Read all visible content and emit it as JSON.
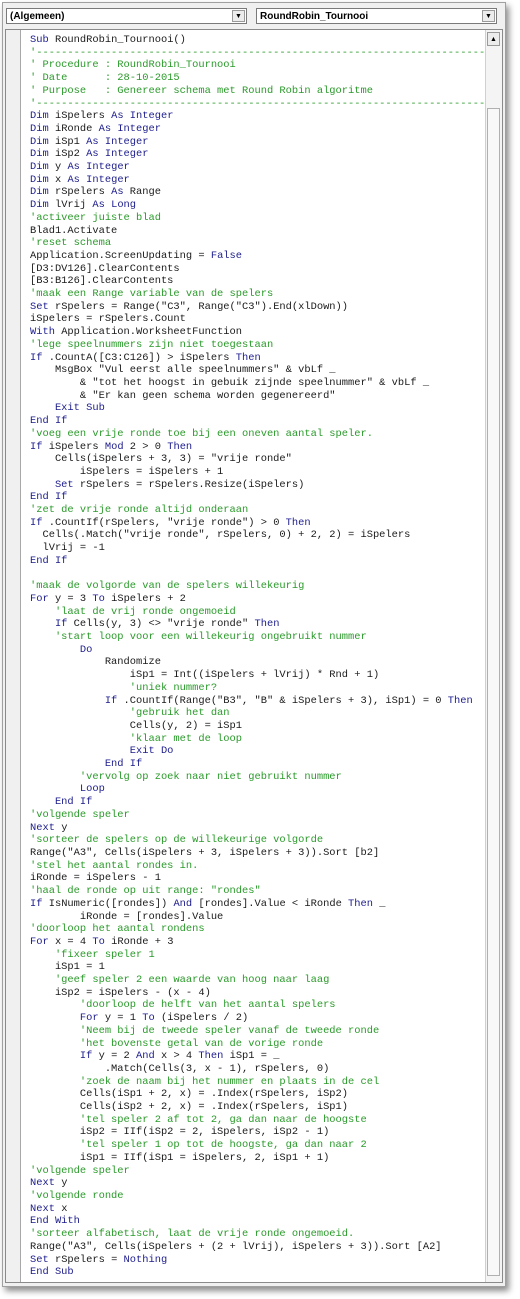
{
  "header": {
    "object_dropdown": "(Algemeen)",
    "procedure_dropdown": "RoundRobin_Tournooi",
    "dropdown_arrow_icon": "▼"
  },
  "scrollbar": {
    "up_arrow_icon": "▲"
  },
  "colors": {
    "keyword": "#1c1c8c",
    "comment": "#2a9a2a",
    "text": "#1a1a1a"
  },
  "code": [
    [
      [
        "k",
        "Sub "
      ],
      [
        "n",
        "RoundRobin_Tournooi()"
      ]
    ],
    [
      [
        "c",
        "'------------------------------------------------------------------------------"
      ]
    ],
    [
      [
        "c",
        "' Procedure : RoundRobin_Tournooi"
      ]
    ],
    [
      [
        "c",
        "' Date      : 28-10-2015"
      ]
    ],
    [
      [
        "c",
        "' Purpose   : Genereer schema met Round Robin algoritme"
      ]
    ],
    [
      [
        "c",
        "'------------------------------------------------------------------------------"
      ]
    ],
    [
      [
        "k",
        "Dim "
      ],
      [
        "n",
        "iSpelers "
      ],
      [
        "k",
        "As Integer"
      ]
    ],
    [
      [
        "k",
        "Dim "
      ],
      [
        "n",
        "iRonde "
      ],
      [
        "k",
        "As Integer"
      ]
    ],
    [
      [
        "k",
        "Dim "
      ],
      [
        "n",
        "iSp1 "
      ],
      [
        "k",
        "As Integer"
      ]
    ],
    [
      [
        "k",
        "Dim "
      ],
      [
        "n",
        "iSp2 "
      ],
      [
        "k",
        "As Integer"
      ]
    ],
    [
      [
        "k",
        "Dim "
      ],
      [
        "n",
        "y "
      ],
      [
        "k",
        "As Integer"
      ]
    ],
    [
      [
        "k",
        "Dim "
      ],
      [
        "n",
        "x "
      ],
      [
        "k",
        "As Integer"
      ]
    ],
    [
      [
        "k",
        "Dim "
      ],
      [
        "n",
        "rSpelers "
      ],
      [
        "k",
        "As "
      ],
      [
        "n",
        "Range"
      ]
    ],
    [
      [
        "k",
        "Dim "
      ],
      [
        "n",
        "lVrij "
      ],
      [
        "k",
        "As Long"
      ]
    ],
    [
      [
        "c",
        "'activeer juiste blad"
      ]
    ],
    [
      [
        "n",
        "Blad1.Activate"
      ]
    ],
    [
      [
        "c",
        "'reset schema"
      ]
    ],
    [
      [
        "n",
        "Application.ScreenUpdating = "
      ],
      [
        "k",
        "False"
      ]
    ],
    [
      [
        "n",
        "[D3:DV126].ClearContents"
      ]
    ],
    [
      [
        "n",
        "[B3:B126].ClearContents"
      ]
    ],
    [
      [
        "c",
        "'maak een Range variable van de spelers"
      ]
    ],
    [
      [
        "k",
        "Set "
      ],
      [
        "n",
        "rSpelers = Range(\"C3\", Range(\"C3\").End(xlDown))"
      ]
    ],
    [
      [
        "n",
        "iSpelers = rSpelers.Count"
      ]
    ],
    [
      [
        "k",
        "With "
      ],
      [
        "n",
        "Application.WorksheetFunction"
      ]
    ],
    [
      [
        "c",
        "'lege speelnummers zijn niet toegestaan"
      ]
    ],
    [
      [
        "k",
        "If "
      ],
      [
        "n",
        ".CountA([C3:C126]) > iSpelers "
      ],
      [
        "k",
        "Then"
      ]
    ],
    [
      [
        "n",
        "    MsgBox \"Vul eerst alle speelnummers\" & vbLf _"
      ]
    ],
    [
      [
        "n",
        "        & \"tot het hoogst in gebuik zijnde speelnummer\" & vbLf _"
      ]
    ],
    [
      [
        "n",
        "        & \"Er kan geen schema worden gegenereerd\""
      ]
    ],
    [
      [
        "k",
        "    Exit Sub"
      ]
    ],
    [
      [
        "k",
        "End If"
      ]
    ],
    [
      [
        "c",
        "'voeg een vrije ronde toe bij een oneven aantal speler."
      ]
    ],
    [
      [
        "k",
        "If "
      ],
      [
        "n",
        "iSpelers "
      ],
      [
        "k",
        "Mod "
      ],
      [
        "n",
        "2 > 0 "
      ],
      [
        "k",
        "Then"
      ]
    ],
    [
      [
        "n",
        "    Cells(iSpelers + 3, 3) = \"vrije ronde\""
      ]
    ],
    [
      [
        "n",
        "        iSpelers = iSpelers + 1"
      ]
    ],
    [
      [
        "k",
        "    Set "
      ],
      [
        "n",
        "rSpelers = rSpelers.Resize(iSpelers)"
      ]
    ],
    [
      [
        "k",
        "End If"
      ]
    ],
    [
      [
        "c",
        "'zet de vrije ronde altijd onderaan"
      ]
    ],
    [
      [
        "k",
        "If "
      ],
      [
        "n",
        ".CountIf(rSpelers, \"vrije ronde\") > 0 "
      ],
      [
        "k",
        "Then"
      ]
    ],
    [
      [
        "n",
        "  Cells(.Match(\"vrije ronde\", rSpelers, 0) + 2, 2) = iSpelers"
      ]
    ],
    [
      [
        "n",
        "  lVrij = -1"
      ]
    ],
    [
      [
        "k",
        "End If"
      ]
    ],
    [
      [
        "n",
        " "
      ]
    ],
    [
      [
        "c",
        "'maak de volgorde van de spelers willekeurig"
      ]
    ],
    [
      [
        "k",
        "For "
      ],
      [
        "n",
        "y = 3 "
      ],
      [
        "k",
        "To "
      ],
      [
        "n",
        "iSpelers + 2"
      ]
    ],
    [
      [
        "c",
        "    'laat de vrij ronde ongemoeid"
      ]
    ],
    [
      [
        "k",
        "    If "
      ],
      [
        "n",
        "Cells(y, 3) <> \"vrije ronde\" "
      ],
      [
        "k",
        "Then"
      ]
    ],
    [
      [
        "c",
        "    'start loop voor een willekeurig ongebruikt nummer"
      ]
    ],
    [
      [
        "k",
        "        Do"
      ]
    ],
    [
      [
        "n",
        "            Randomize"
      ]
    ],
    [
      [
        "n",
        "                iSp1 = Int((iSpelers + lVrij) * Rnd + 1)"
      ]
    ],
    [
      [
        "c",
        "                'uniek nummer?"
      ]
    ],
    [
      [
        "k",
        "            If "
      ],
      [
        "n",
        ".CountIf(Range(\"B3\", \"B\" & iSpelers + 3), iSp1) = 0 "
      ],
      [
        "k",
        "Then"
      ]
    ],
    [
      [
        "c",
        "                'gebruik het dan"
      ]
    ],
    [
      [
        "n",
        "                Cells(y, 2) = iSp1"
      ]
    ],
    [
      [
        "c",
        "                'klaar met de loop"
      ]
    ],
    [
      [
        "k",
        "                Exit Do"
      ]
    ],
    [
      [
        "k",
        "            End If"
      ]
    ],
    [
      [
        "c",
        "        'vervolg op zoek naar niet gebruikt nummer"
      ]
    ],
    [
      [
        "k",
        "        Loop"
      ]
    ],
    [
      [
        "k",
        "    End If"
      ]
    ],
    [
      [
        "c",
        "'volgende speler"
      ]
    ],
    [
      [
        "k",
        "Next "
      ],
      [
        "n",
        "y"
      ]
    ],
    [
      [
        "c",
        "'sorteer de spelers op de willekeurige volgorde"
      ]
    ],
    [
      [
        "n",
        "Range(\"A3\", Cells(iSpelers + 3, iSpelers + 3)).Sort [b2]"
      ]
    ],
    [
      [
        "c",
        "'stel het aantal rondes in."
      ]
    ],
    [
      [
        "n",
        "iRonde = iSpelers - 1"
      ]
    ],
    [
      [
        "c",
        "'haal de ronde op uit range: \"rondes\""
      ]
    ],
    [
      [
        "k",
        "If "
      ],
      [
        "n",
        "IsNumeric([rondes]) "
      ],
      [
        "k",
        "And "
      ],
      [
        "n",
        "[rondes].Value < iRonde "
      ],
      [
        "k",
        "Then "
      ],
      [
        "n",
        "_"
      ]
    ],
    [
      [
        "n",
        "        iRonde = [rondes].Value"
      ]
    ],
    [
      [
        "c",
        "'doorloop het aantal rondens"
      ]
    ],
    [
      [
        "k",
        "For "
      ],
      [
        "n",
        "x = 4 "
      ],
      [
        "k",
        "To "
      ],
      [
        "n",
        "iRonde + 3"
      ]
    ],
    [
      [
        "c",
        "    'fixeer speler 1"
      ]
    ],
    [
      [
        "n",
        "    iSp1 = 1"
      ]
    ],
    [
      [
        "c",
        "    'geef speler 2 een waarde van hoog naar laag"
      ]
    ],
    [
      [
        "n",
        "    iSp2 = iSpelers - (x - 4)"
      ]
    ],
    [
      [
        "c",
        "        'doorloop de helft van het aantal spelers"
      ]
    ],
    [
      [
        "k",
        "        For "
      ],
      [
        "n",
        "y = 1 "
      ],
      [
        "k",
        "To "
      ],
      [
        "n",
        "(iSpelers / 2)"
      ]
    ],
    [
      [
        "c",
        "        'Neem bij de tweede speler vanaf de tweede ronde"
      ]
    ],
    [
      [
        "c",
        "        'het bovenste getal van de vorige ronde"
      ]
    ],
    [
      [
        "k",
        "        If "
      ],
      [
        "n",
        "y = 2 "
      ],
      [
        "k",
        "And "
      ],
      [
        "n",
        "x > 4 "
      ],
      [
        "k",
        "Then "
      ],
      [
        "n",
        "iSp1 = _"
      ]
    ],
    [
      [
        "n",
        "            .Match(Cells(3, x - 1), rSpelers, 0)"
      ]
    ],
    [
      [
        "c",
        "        'zoek de naam bij het nummer en plaats in de cel"
      ]
    ],
    [
      [
        "n",
        "        Cells(iSp1 + 2, x) = .Index(rSpelers, iSp2)"
      ]
    ],
    [
      [
        "n",
        "        Cells(iSp2 + 2, x) = .Index(rSpelers, iSp1)"
      ]
    ],
    [
      [
        "c",
        "        'tel speler 2 af tot 2, ga dan naar de hoogste"
      ]
    ],
    [
      [
        "n",
        "        iSp2 = IIf(iSp2 = 2, iSpelers, iSp2 - 1)"
      ]
    ],
    [
      [
        "c",
        "        'tel speler 1 op tot de hoogste, ga dan naar 2"
      ]
    ],
    [
      [
        "n",
        "        iSp1 = IIf(iSp1 = iSpelers, 2, iSp1 + 1)"
      ]
    ],
    [
      [
        "c",
        "'volgende speler"
      ]
    ],
    [
      [
        "k",
        "Next "
      ],
      [
        "n",
        "y"
      ]
    ],
    [
      [
        "c",
        "'volgende ronde"
      ]
    ],
    [
      [
        "k",
        "Next "
      ],
      [
        "n",
        "x"
      ]
    ],
    [
      [
        "k",
        "End With"
      ]
    ],
    [
      [
        "c",
        "'sorteer alfabetisch, laat de vrije ronde ongemoeid."
      ]
    ],
    [
      [
        "n",
        "Range(\"A3\", Cells(iSpelers + (2 + lVrij), iSpelers + 3)).Sort [A2]"
      ]
    ],
    [
      [
        "k",
        "Set "
      ],
      [
        "n",
        "rSpelers = "
      ],
      [
        "k",
        "Nothing"
      ]
    ],
    [
      [
        "k",
        "End Sub"
      ]
    ]
  ]
}
